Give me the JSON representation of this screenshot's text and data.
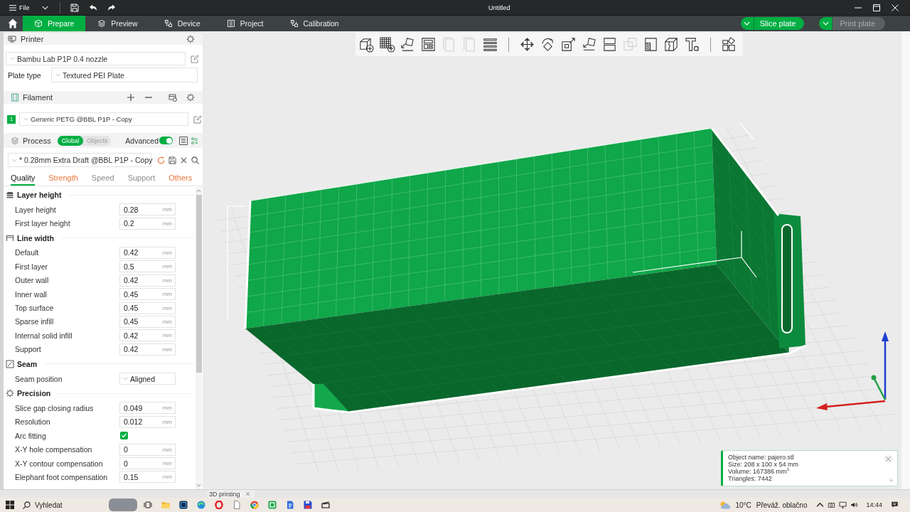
{
  "window": {
    "title": "Untitled",
    "menu_label": "File"
  },
  "main_tabs": [
    {
      "label": "Prepare",
      "selected": true
    },
    {
      "label": "Preview",
      "selected": false
    },
    {
      "label": "Device",
      "selected": false
    },
    {
      "label": "Project",
      "selected": false
    },
    {
      "label": "Calibration",
      "selected": false
    }
  ],
  "plate_actions": [
    {
      "label": "Slice plate",
      "disabled": false
    },
    {
      "label": "Print plate",
      "disabled": true
    }
  ],
  "sidebar": {
    "printer": {
      "title": "Printer",
      "preset": "Bambu Lab P1P 0.4 nozzle",
      "plate_type_label": "Plate type",
      "plate_type": "Textured PEI Plate"
    },
    "filament": {
      "title": "Filament",
      "slots": [
        {
          "number": "1",
          "name": "Generic PETG @BBL P1P - Copy",
          "color": "#00ae42"
        }
      ]
    },
    "process": {
      "title": "Process",
      "scope": [
        {
          "label": "Global",
          "selected": true
        },
        {
          "label": "Objects",
          "selected": false
        }
      ],
      "advanced_label": "Advanced",
      "advanced": true,
      "preset": "* 0.28mm Extra Draft @BBL P1P - Copy",
      "tabs": [
        {
          "label": "Quality",
          "selected": true,
          "modified": false
        },
        {
          "label": "Strength",
          "selected": false,
          "modified": true
        },
        {
          "label": "Speed",
          "selected": false,
          "modified": false
        },
        {
          "label": "Support",
          "selected": false,
          "modified": false
        },
        {
          "label": "Others",
          "selected": false,
          "modified": true
        }
      ],
      "groups": [
        {
          "title": "Layer height",
          "settings": [
            {
              "kind": "number",
              "label": "Layer height",
              "value": "0.28",
              "unit": "mm"
            },
            {
              "kind": "number",
              "label": "First layer height",
              "value": "0.2",
              "unit": "mm"
            }
          ]
        },
        {
          "title": "Line width",
          "settings": [
            {
              "kind": "number",
              "label": "Default",
              "value": "0.42",
              "unit": "mm"
            },
            {
              "kind": "number",
              "label": "First layer",
              "value": "0.5",
              "unit": "mm"
            },
            {
              "kind": "number",
              "label": "Outer wall",
              "value": "0.42",
              "unit": "mm"
            },
            {
              "kind": "number",
              "label": "Inner wall",
              "value": "0.45",
              "unit": "mm"
            },
            {
              "kind": "number",
              "label": "Top surface",
              "value": "0.45",
              "unit": "mm"
            },
            {
              "kind": "number",
              "label": "Sparse infill",
              "value": "0.45",
              "unit": "mm"
            },
            {
              "kind": "number",
              "label": "Internal solid infill",
              "value": "0.42",
              "unit": "mm"
            },
            {
              "kind": "number",
              "label": "Support",
              "value": "0.42",
              "unit": "mm"
            }
          ]
        },
        {
          "title": "Seam",
          "settings": [
            {
              "kind": "select",
              "label": "Seam position",
              "value": "Aligned"
            }
          ]
        },
        {
          "title": "Precision",
          "settings": [
            {
              "kind": "number",
              "label": "Slice gap closing radius",
              "value": "0.049",
              "unit": "mm"
            },
            {
              "kind": "number",
              "label": "Resolution",
              "value": "0.012",
              "unit": "mm"
            },
            {
              "kind": "checkbox",
              "label": "Arc fitting",
              "checked": true
            },
            {
              "kind": "number",
              "label": "X-Y hole compensation",
              "value": "0",
              "unit": "mm"
            },
            {
              "kind": "number",
              "label": "X-Y contour compensation",
              "value": "0",
              "unit": "mm"
            },
            {
              "kind": "number",
              "label": "Elephant foot compensation",
              "value": "0.15",
              "unit": "mm"
            }
          ]
        }
      ]
    }
  },
  "viewport": {
    "object_info": {
      "lines": [
        "Object name: pajero.stl",
        "Size: 208 x 100 x 54 mm",
        "Volume: 167386 mm$^{3}$",
        "Triangles: 7442"
      ]
    }
  },
  "background_tab": {
    "label": "3D printing"
  },
  "taskbar": {
    "search_placeholder": "Vyhledat",
    "temperature": "10°C",
    "weather": "Převáž. oblačno",
    "time": "14:44"
  }
}
